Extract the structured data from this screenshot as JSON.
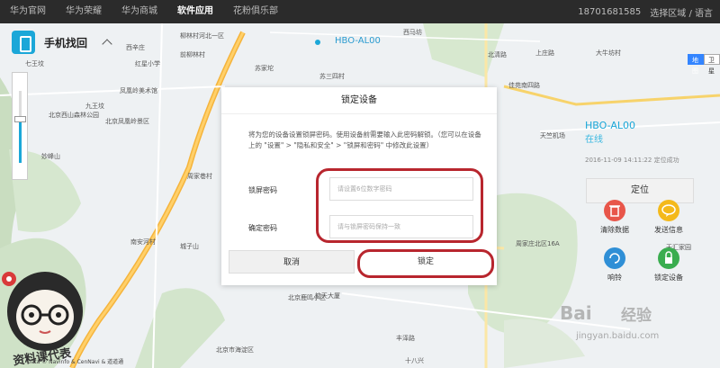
{
  "topbar": {
    "nav": [
      "华为官网",
      "华为荣耀",
      "华为商城",
      "软件应用",
      "花粉俱乐部"
    ],
    "active_index": 3,
    "account": "18701681585",
    "region": "选择区域 / 语言"
  },
  "app": {
    "title": "手机找回"
  },
  "map": {
    "maptype": [
      "地图",
      "卫星"
    ],
    "labels": [
      "七王坟",
      "西辛庄",
      "柳林村河北一区",
      "西马坊",
      "红星小学",
      "前柳林村",
      "苏家坨",
      "凤凰岭美术馆",
      "九王坟",
      "北京西山森林公园",
      "北京凤凰岭景区",
      "北京凤凰岭自然风景区",
      "妙峰山",
      "南安河村",
      "城子山",
      "周家巷村",
      "高崖口村",
      "车耳营村",
      "百望山",
      "西北旺",
      "苏三四村",
      "温泉路",
      "北清路",
      "上庄路",
      "大牛坊村",
      "天惠丰庄",
      "华迅小学",
      "佳苑南四路",
      "新村村创业大厦",
      "天竺机场",
      "周家庄北区16A",
      "永丰小学",
      "宏冶公园",
      "西红山",
      "百望山",
      "天汇家园",
      "韩家川村",
      "宏丰小区",
      "沃家苑",
      "航天大厦",
      "白家疃景观休闲园",
      "北京鹿鸣小区",
      "西河滩",
      "丰泽路",
      "十八兴",
      "北京市海淀区",
      "莲花池村",
      "北京化工大学",
      "北京西山农场",
      "八达岭高速",
      "妙峰山风景区",
      "京包高速",
      "城铁路",
      "太阳园",
      "大觉寺"
    ],
    "copyright": "Data © Navinfo & CenNavi & 道道通"
  },
  "device": {
    "name": "HBO-AL00",
    "status": "在线",
    "time": "2016-11-09 14:11:22 定位成功",
    "locate_label": "定位"
  },
  "actions": [
    {
      "label": "清除数据",
      "color": "#e8564a",
      "icon": "trash-icon"
    },
    {
      "label": "发送信息",
      "color": "#f4b91b",
      "icon": "message-icon"
    },
    {
      "label": "响铃",
      "color": "#2f8fd6",
      "icon": "refresh-icon"
    },
    {
      "label": "锁定设备",
      "color": "#3aad4f",
      "icon": "lock-icon"
    }
  ],
  "dialog": {
    "title": "锁定设备",
    "desc": "将为您的设备设置锁屏密码。使用设备前需要输入此密码解锁。（您可以在设备上的 \"设置\" > \"隐私和安全\" > \"锁屏和密码\" 中修改此设置）",
    "pwd_label": "锁屏密码",
    "pwd_placeholder": "请设置6位数字密码",
    "confirm_label": "确定密码",
    "confirm_placeholder": "请与锁屏密码保持一致",
    "cancel_label": "取消",
    "lock_label": "锁定"
  },
  "watermark": {
    "brand": "Bai",
    "logo": "经验",
    "url": "jingyan.baidu.com"
  },
  "sticker": {
    "text": "资料课代表"
  }
}
